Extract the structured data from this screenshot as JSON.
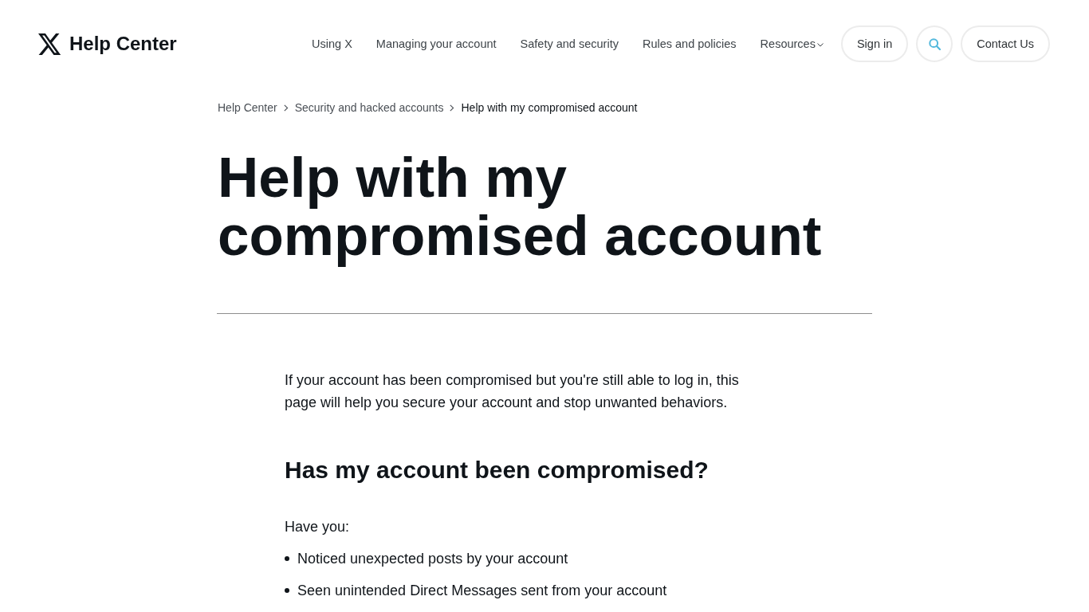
{
  "header": {
    "brand": "Help Center",
    "nav": [
      {
        "label": "Using X",
        "kind": "link"
      },
      {
        "label": "Managing your account",
        "kind": "link"
      },
      {
        "label": "Safety and security",
        "kind": "link"
      },
      {
        "label": "Rules and policies",
        "kind": "link"
      },
      {
        "label": "Resources",
        "kind": "dropdown"
      }
    ],
    "sign_in": "Sign in",
    "contact": "Contact Us"
  },
  "breadcrumb": [
    {
      "label": "Help Center",
      "current": false
    },
    {
      "label": "Security and hacked accounts",
      "current": false
    },
    {
      "label": "Help with my compromised account",
      "current": true
    }
  ],
  "title": "Help with my compromised account",
  "intro": "If your account has been compromised but you're still able to log in, this page will help you secure your account and stop unwanted behaviors.",
  "section": {
    "heading": "Has my account been compromised?",
    "lead": "Have you:",
    "bullets": [
      "Noticed unexpected posts by your account",
      "Seen unintended Direct Messages sent from your account"
    ]
  }
}
